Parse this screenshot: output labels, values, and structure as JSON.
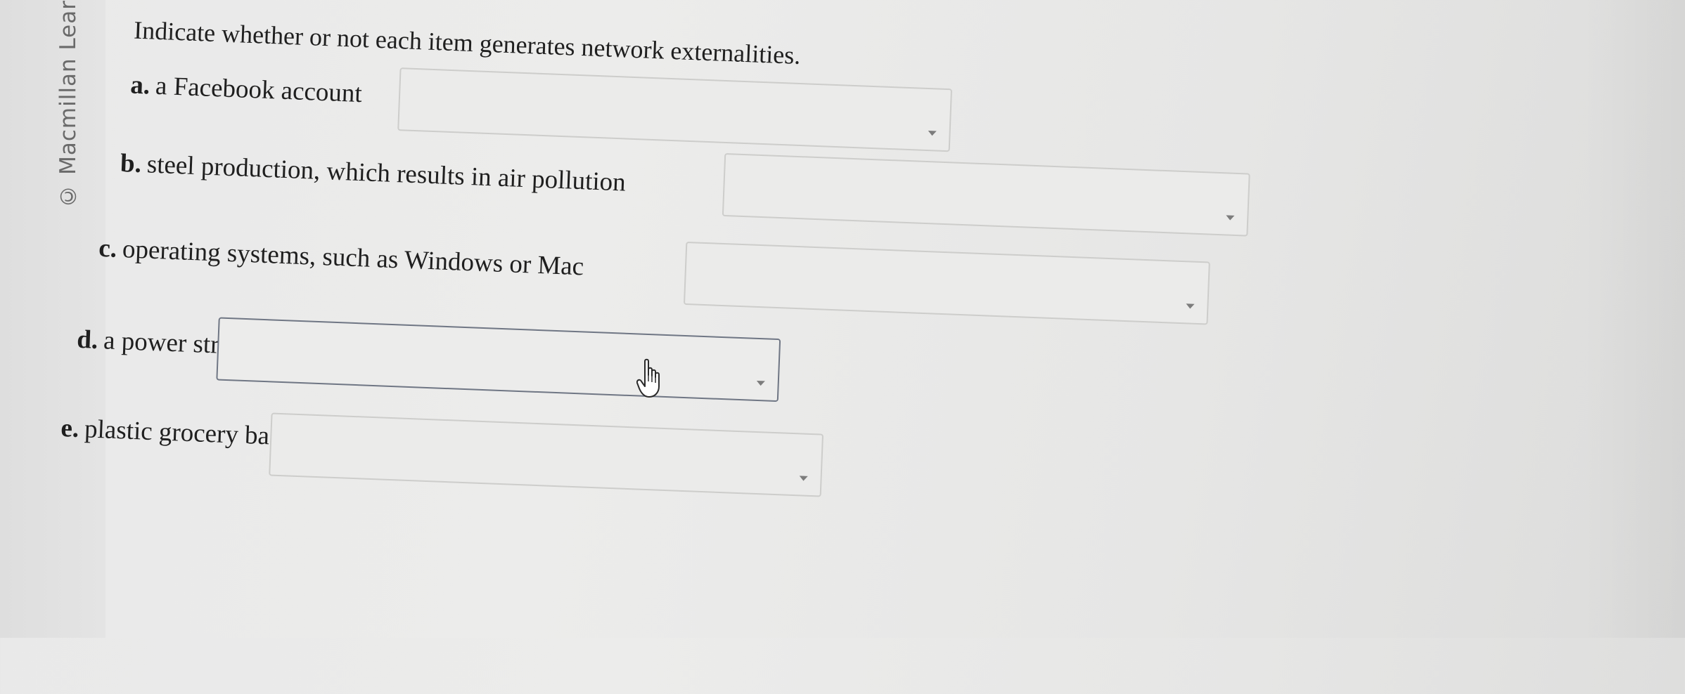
{
  "watermark": {
    "copyright": "© Macmillan Lear"
  },
  "question": {
    "prompt": "Indicate whether or not each item generates network externalities.",
    "items": [
      {
        "letter": "a.",
        "text": "a Facebook account",
        "selected": ""
      },
      {
        "letter": "b.",
        "text": "steel production, which results in air pollution",
        "selected": ""
      },
      {
        "letter": "c.",
        "text": "operating systems, such as Windows or Mac",
        "selected": ""
      },
      {
        "letter": "d.",
        "text": "a power strip",
        "selected": ""
      },
      {
        "letter": "e.",
        "text": "plastic grocery bags",
        "selected": ""
      }
    ]
  },
  "icons": {
    "dropdown": "chevron-down-icon",
    "cursor": "hand-pointer-cursor-icon"
  },
  "colors": {
    "text": "#1f1f1f",
    "select_bg": "#ebebea",
    "select_border": "#cdcdcb",
    "hover_border": "#6f7684",
    "caret": "#7c7c7c"
  }
}
